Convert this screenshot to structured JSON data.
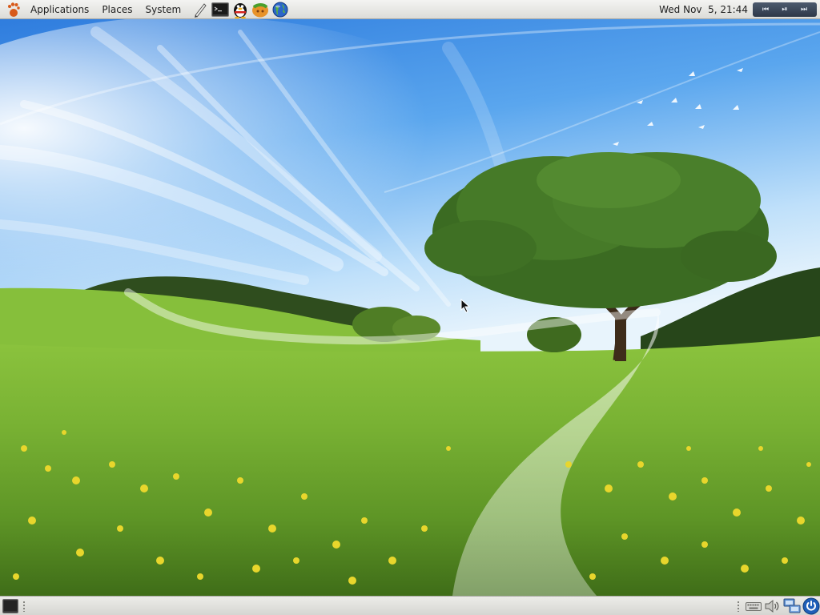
{
  "top_panel": {
    "menus": [
      {
        "label": "Applications"
      },
      {
        "label": "Places"
      },
      {
        "label": "System"
      }
    ],
    "launchers": [
      {
        "name": "text-editor-launcher",
        "icon": "text-editor-icon"
      },
      {
        "name": "terminal-launcher",
        "icon": "terminal-icon"
      },
      {
        "name": "qq-messenger-launcher",
        "icon": "penguin-icon"
      },
      {
        "name": "game-launcher",
        "icon": "game-icon"
      },
      {
        "name": "web-browser-launcher",
        "icon": "globe-icon"
      }
    ],
    "clock": "Wed Nov  5, 21:44",
    "media_controls": {
      "prev": "⏮",
      "play_pause": "⏯",
      "next": "⏭"
    }
  },
  "bottom_panel": {
    "show_desktop_icon": "show-desktop-icon",
    "tray_icons": [
      "keyboard-icon",
      "volume-icon",
      "network-icon",
      "power-icon"
    ]
  },
  "theme": {
    "panel_bg": "#e6e6e2",
    "sky_top": "#1f6fd6",
    "sky_light": "#a9d4ff",
    "grass": "#7eb53a",
    "flowers": "#e8d62c"
  }
}
